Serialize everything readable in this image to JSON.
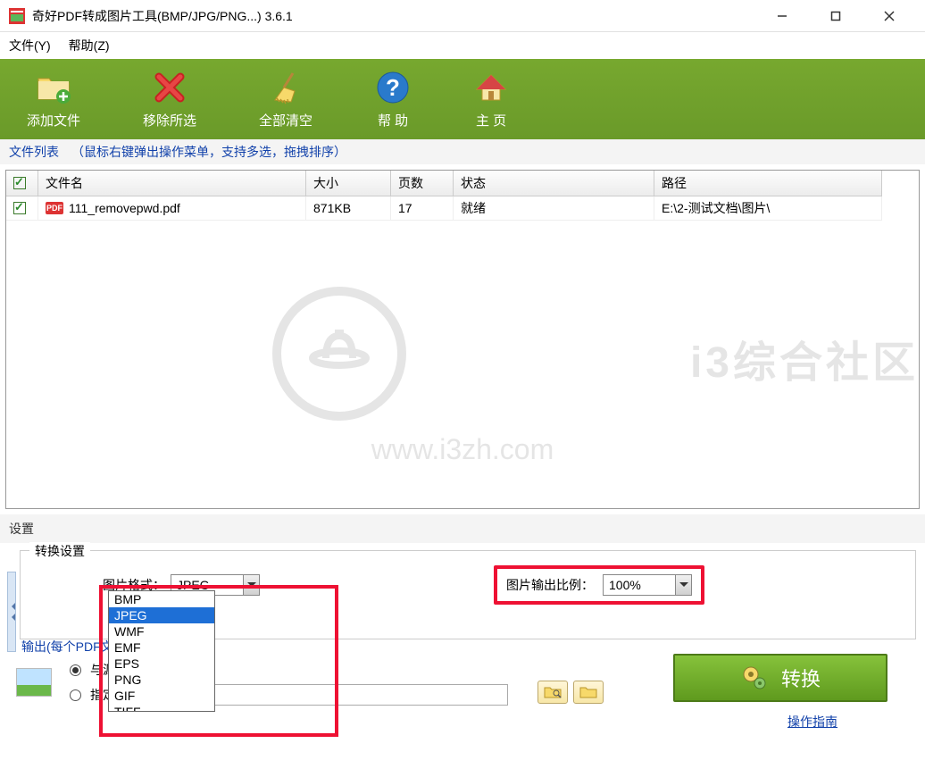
{
  "window": {
    "title": "奇好PDF转成图片工具(BMP/JPG/PNG...) 3.6.1"
  },
  "menu": {
    "file": "文件(Y)",
    "help": "帮助(Z)"
  },
  "toolbar": {
    "add": "添加文件",
    "remove": "移除所选",
    "clear": "全部清空",
    "help": "帮   助",
    "home": "主   页"
  },
  "filelist": {
    "label": "文件列表",
    "hint": "（鼠标右键弹出操作菜单，支持多选，拖拽排序）",
    "cols": {
      "name": "文件名",
      "size": "大小",
      "pages": "页数",
      "status": "状态",
      "path": "路径"
    },
    "rows": [
      {
        "name": "111_removepwd.pdf",
        "size": "871KB",
        "pages": "17",
        "status": "就绪",
        "path": "E:\\2-测试文档\\图片\\"
      }
    ]
  },
  "watermark": {
    "text": "i3综合社区",
    "url": "www.i3zh.com"
  },
  "settings": {
    "label": "设置",
    "group": "转换设置",
    "format_label": "图片格式：",
    "format_value": "JPEG",
    "format_options": [
      "BMP",
      "JPEG",
      "WMF",
      "EMF",
      "EPS",
      "PNG",
      "GIF",
      "TIFF"
    ],
    "ratio_label": "图片输出比例：",
    "ratio_value": "100%"
  },
  "output": {
    "legend": "输出(每个PDF文件一个文",
    "same_dir": "与源文件保存",
    "spec_dir": "指定路径"
  },
  "convert": {
    "label": "转换",
    "guide": "操作指南"
  }
}
